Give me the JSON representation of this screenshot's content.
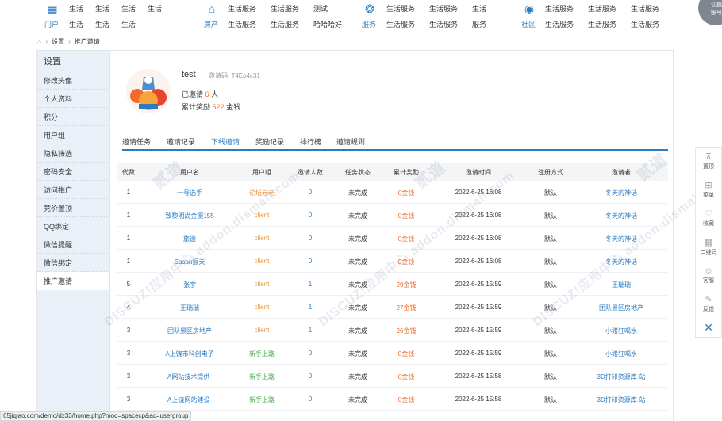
{
  "nav": {
    "groups": [
      {
        "icon": "portal-icon",
        "glyph": "▦",
        "category": "门户",
        "row1": [
          "生活",
          "生活",
          "生活",
          "生活"
        ],
        "row2": [
          "生活",
          "生活",
          "生活"
        ]
      },
      {
        "icon": "house-icon",
        "glyph": "⌂",
        "category": "房产",
        "row1": [
          "生活服务",
          "生活服务",
          "测试"
        ],
        "row2": [
          "生活服务",
          "生活服务",
          "哈哈哈好"
        ]
      },
      {
        "icon": "service-icon",
        "glyph": "❂",
        "category": "服务",
        "row1": [
          "生活服务",
          "生活服务",
          "生活"
        ],
        "row2": [
          "生活服务",
          "生活服务",
          "服务"
        ]
      },
      {
        "icon": "community-icon",
        "glyph": "◉",
        "category": "社区",
        "row1": [
          "生活服务",
          "生活服务",
          "生活服务"
        ],
        "row2": [
          "生活服务",
          "生活服务",
          "生活服务"
        ]
      }
    ]
  },
  "breadcrumb": {
    "home_icon": "home-icon",
    "items": [
      "设置",
      "推广邀请"
    ]
  },
  "sidebar": {
    "title": "设置",
    "items": [
      "修改头像",
      "个人资料",
      "积分",
      "用户组",
      "隐私筛选",
      "密码安全",
      "访问推广",
      "竞价置顶",
      "QQ绑定",
      "微信提醒",
      "微信绑定",
      "推广邀请"
    ],
    "active_index": 11
  },
  "profile": {
    "username": "test",
    "invite_code": "邀请码: T4Eo4c31",
    "invited_prefix": "已邀请",
    "invited_count": "6",
    "invited_suffix": "人",
    "reward_prefix": "累计奖励",
    "reward_amount": "522",
    "reward_suffix": "金钱"
  },
  "tabs": [
    "邀请任务",
    "邀请记录",
    "下线邀请",
    "奖励记录",
    "排行榜",
    "邀请规则"
  ],
  "active_tab": 2,
  "table": {
    "headers": [
      "代数",
      "用户名",
      "用户组",
      "邀请人数",
      "任务状态",
      "累计奖励",
      "邀请时间",
      "注册方式",
      "邀请者"
    ],
    "rows": [
      [
        "1",
        "一号选手",
        "论坛元老",
        "0",
        "未完成",
        "0金钱",
        "2022-6-25 16:08",
        "默认",
        "冬天的神话"
      ],
      [
        "1",
        "致黎明尚金摄155",
        "client",
        "0",
        "未完成",
        "0金钱",
        "2022-6-25 16:08",
        "默认",
        "冬天的神话"
      ],
      [
        "1",
        "旅途",
        "client",
        "0",
        "未完成",
        "0金钱",
        "2022-6-25 16:08",
        "默认",
        "冬天的神话"
      ],
      [
        "1",
        "Eason振天",
        "client",
        "0",
        "未完成",
        "0金钱",
        "2022-6-25 16:08",
        "默认",
        "冬天的神话"
      ],
      [
        "5",
        "张宇",
        "client",
        "1",
        "未完成",
        "29金钱",
        "2022-6-25 15:59",
        "默认",
        "王瑞瑞"
      ],
      [
        "4",
        "王瑞瑞",
        "client",
        "1",
        "未完成",
        "27金钱",
        "2022-6-25 15:59",
        "默认",
        "团队景区房地产"
      ],
      [
        "3",
        "团队景区房地产",
        "client",
        "1",
        "未完成",
        "26金钱",
        "2022-6-25 15:59",
        "默认",
        "小猪狂喝水"
      ],
      [
        "3",
        "A上饶市科创电子",
        "新手上路",
        "0",
        "未完成",
        "0金钱",
        "2022-6-25 15:59",
        "默认",
        "小猪狂喝水"
      ],
      [
        "3",
        "A网站技术提供-",
        "新手上路",
        "0",
        "未完成",
        "0金钱",
        "2022-6-25 15:58",
        "默认",
        "3D打印资源库-站"
      ],
      [
        "3",
        "A上饶网站建设-",
        "新手上路",
        "0",
        "未完成",
        "0金钱",
        "2022-6-25 15:58",
        "默认",
        "3D打印资源库-站"
      ]
    ]
  },
  "watermark": "DISCUZ!应用中心 addon.dismall.com",
  "watermark_word": "贰道",
  "rightbar": {
    "items": [
      {
        "icon": "top-icon",
        "glyph": "⊼",
        "label": "置顶"
      },
      {
        "icon": "menu-icon",
        "glyph": "⊞",
        "label": "菜单"
      },
      {
        "icon": "favorite-icon",
        "glyph": "♡",
        "label": "收藏"
      },
      {
        "icon": "qrcode-icon",
        "glyph": "▦",
        "label": "二维码"
      },
      {
        "icon": "support-icon",
        "glyph": "☺",
        "label": "客服"
      },
      {
        "icon": "feedback-icon",
        "glyph": "✎",
        "label": "反馈"
      }
    ],
    "close_glyph": "✕"
  },
  "corner": {
    "line1": "切换",
    "line2": "账号"
  },
  "statusbar": "65jiqiao.com/demo/dz33/home.php?mod=spacecp&ac=usergroup",
  "colors": {
    "accent": "#2b7bc0",
    "highlight": "#f26a2d",
    "group": "#e8903a",
    "sidebar_bg": "#e9f0f8"
  }
}
